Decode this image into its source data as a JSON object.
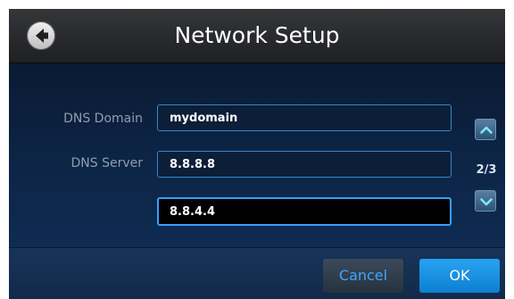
{
  "header": {
    "title": "Network Setup",
    "back_icon": "arrow-left-circle-icon"
  },
  "form": {
    "dns_domain": {
      "label": "DNS Domain",
      "value": "mydomain"
    },
    "dns_server": {
      "label": "DNS Server",
      "value": "8.8.8.8"
    },
    "dns_server_2": {
      "value": "8.8.4.4"
    }
  },
  "pager": {
    "indicator": "2/3",
    "up_icon": "chevron-up-icon",
    "down_icon": "chevron-down-icon"
  },
  "footer": {
    "cancel_label": "Cancel",
    "ok_label": "OK"
  },
  "colors": {
    "accent": "#2d8ad6",
    "ok_button": "#1691e2",
    "cancel_text": "#3fa6ff"
  }
}
